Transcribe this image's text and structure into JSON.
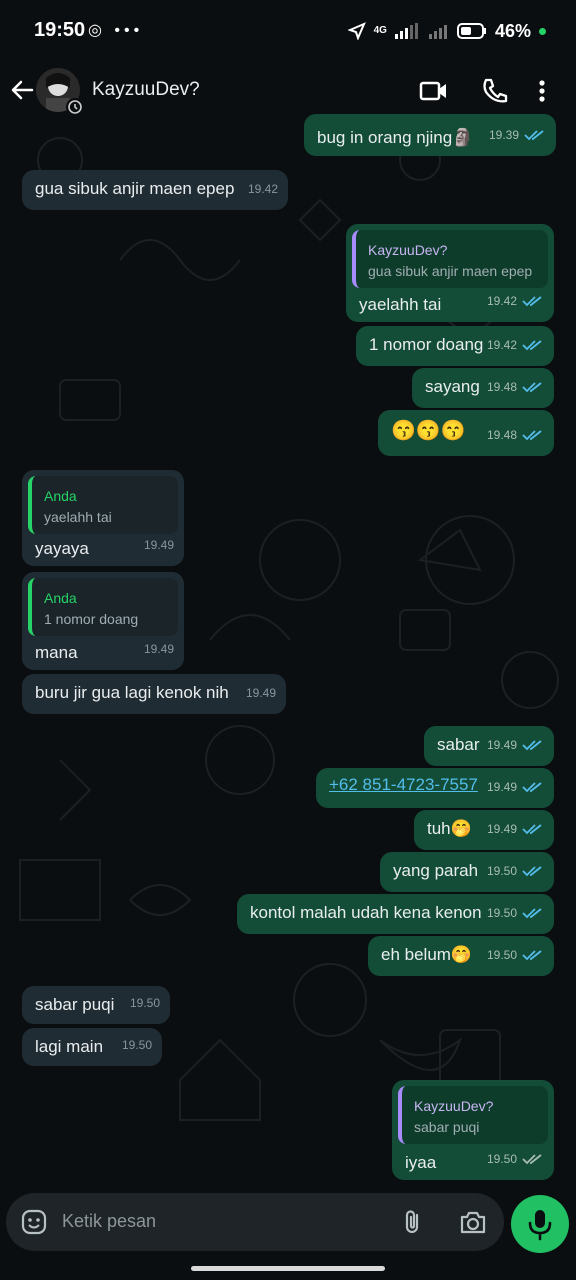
{
  "status_bar": {
    "time": "19:50",
    "left_icons": "◎ •••",
    "network": "4G",
    "battery": "46%"
  },
  "header": {
    "contact_name": "KayzuuDev?"
  },
  "messages": [
    {
      "dir": "out",
      "text": "bug in orang njing🗿",
      "time": "19.39",
      "ticks": "read"
    },
    {
      "dir": "in",
      "text": "gua sibuk anjir maen epep",
      "time": "19.42"
    },
    {
      "dir": "out",
      "reply_author": "KayzuuDev?",
      "reply_text": "gua sibuk anjir maen epep",
      "text": "yaelahh tai",
      "time": "19.42",
      "ticks": "read"
    },
    {
      "dir": "out",
      "text": "1 nomor doang",
      "time": "19.42",
      "ticks": "read"
    },
    {
      "dir": "out",
      "text": "sayang",
      "time": "19.48",
      "ticks": "read"
    },
    {
      "dir": "out",
      "text": "😙😙😙",
      "time": "19.48",
      "ticks": "read"
    },
    {
      "dir": "in",
      "reply_author": "Anda",
      "reply_text": "yaelahh tai",
      "text": "yayaya",
      "time": "19.49"
    },
    {
      "dir": "in",
      "reply_author": "Anda",
      "reply_text": "1 nomor doang",
      "text": "mana",
      "time": "19.49"
    },
    {
      "dir": "in",
      "text": "buru jir gua lagi kenok nih",
      "time": "19.49"
    },
    {
      "dir": "out",
      "text": "sabar",
      "time": "19.49",
      "ticks": "read"
    },
    {
      "dir": "out",
      "text": "+62 851-4723-7557",
      "time": "19.49",
      "ticks": "read",
      "link": true
    },
    {
      "dir": "out",
      "text": "tuh🤭",
      "time": "19.49",
      "ticks": "read"
    },
    {
      "dir": "out",
      "text": "yang parah",
      "time": "19.50",
      "ticks": "read"
    },
    {
      "dir": "out",
      "text": "kontol malah udah kena kenon",
      "time": "19.50",
      "ticks": "read"
    },
    {
      "dir": "out",
      "text": "eh belum🤭",
      "time": "19.50",
      "ticks": "read"
    },
    {
      "dir": "in",
      "text": "sabar puqi",
      "time": "19.50"
    },
    {
      "dir": "in",
      "text": "lagi main",
      "time": "19.50"
    },
    {
      "dir": "out",
      "reply_author": "KayzuuDev?",
      "reply_text": "sabar puqi",
      "text": "iyaa",
      "time": "19.50",
      "ticks": "delivered"
    }
  ],
  "composer": {
    "placeholder": "Ketik pesan"
  },
  "colors": {
    "outgoing_bubble": "#134d37",
    "incoming_bubble": "#202c33",
    "accent": "#21c063",
    "read_ticks": "#53bdeb"
  },
  "icons": [
    "back-arrow-icon",
    "video-call-icon",
    "phone-icon",
    "more-vert-icon",
    "emoji-icon",
    "attach-icon",
    "camera-icon",
    "mic-icon"
  ]
}
